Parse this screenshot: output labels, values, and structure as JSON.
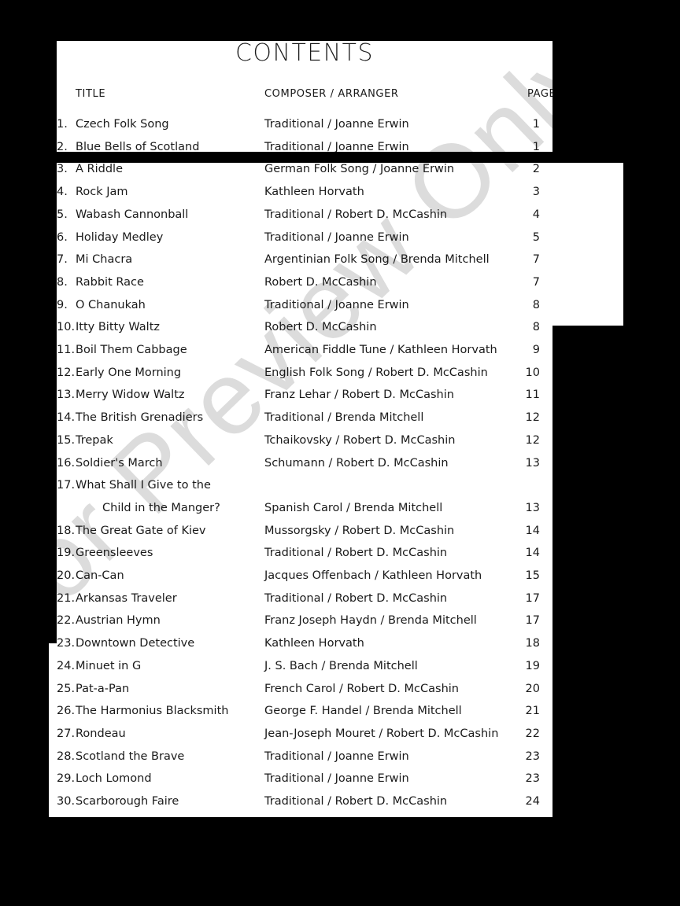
{
  "document": {
    "heading": "CONTENTS",
    "watermark": "For Preview Only",
    "watermark_color": "#dcdcdc",
    "page_background": "#ffffff",
    "canvas_background": "#000000",
    "text_color": "#1a1a1a"
  },
  "columns": {
    "title": "TITLE",
    "composer": "COMPOSER / ARRANGER",
    "page": "PAGE"
  },
  "entries": [
    {
      "num": "1.",
      "title": "Czech Folk Song",
      "composer": "Traditional / Joanne Erwin",
      "page": "1"
    },
    {
      "num": "2.",
      "title": "Blue Bells of Scotland",
      "composer": "Traditional / Joanne Erwin",
      "page": "1"
    },
    {
      "num": "3.",
      "title": "A Riddle",
      "composer": "German Folk Song / Joanne Erwin",
      "page": "2"
    },
    {
      "num": "4.",
      "title": "Rock Jam",
      "composer": "Kathleen Horvath",
      "page": "3"
    },
    {
      "num": "5.",
      "title": "Wabash Cannonball",
      "composer": "Traditional / Robert D. McCashin",
      "page": "4"
    },
    {
      "num": "6.",
      "title": "Holiday Medley",
      "composer": "Traditional / Joanne Erwin",
      "page": "5"
    },
    {
      "num": "7.",
      "title": "Mi Chacra",
      "composer": "Argentinian Folk Song / Brenda Mitchell",
      "page": "7"
    },
    {
      "num": "8.",
      "title": "Rabbit Race",
      "composer": "Robert D. McCashin",
      "page": "7"
    },
    {
      "num": "9.",
      "title": "O Chanukah",
      "composer": "Traditional / Joanne Erwin",
      "page": "8"
    },
    {
      "num": "10.",
      "title": "Itty Bitty Waltz",
      "composer": "Robert D. McCashin",
      "page": "8"
    },
    {
      "num": "11.",
      "title": "Boil Them Cabbage",
      "composer": "American Fiddle Tune / Kathleen Horvath",
      "page": "9"
    },
    {
      "num": "12.",
      "title": "Early One Morning",
      "composer": "English Folk Song / Robert D. McCashin",
      "page": "10"
    },
    {
      "num": "13.",
      "title": "Merry Widow Waltz",
      "composer": "Franz Lehar / Robert D. McCashin",
      "page": "11"
    },
    {
      "num": "14.",
      "title": "The British Grenadiers",
      "composer": "Traditional  / Brenda Mitchell",
      "page": "12"
    },
    {
      "num": "15.",
      "title": "Trepak",
      "composer": "Tchaikovsky / Robert D. McCashin",
      "page": "12"
    },
    {
      "num": "16.",
      "title": "Soldier's March",
      "composer": "Schumann / Robert D. McCashin",
      "page": "13"
    },
    {
      "num": "17.",
      "title": "What Shall I Give to the",
      "composer": "",
      "page": ""
    },
    {
      "num": "",
      "title": "Child in the Manger?",
      "composer": "Spanish Carol / Brenda Mitchell",
      "page": "13",
      "indented": true
    },
    {
      "num": "18.",
      "title": "The Great Gate of Kiev",
      "composer": "Mussorgsky / Robert D. McCashin",
      "page": "14"
    },
    {
      "num": "19.",
      "title": "Greensleeves",
      "composer": "Traditional / Robert D. McCashin",
      "page": "14"
    },
    {
      "num": "20.",
      "title": "Can-Can",
      "composer": "Jacques Offenbach / Kathleen Horvath",
      "page": "15"
    },
    {
      "num": "21.",
      "title": "Arkansas Traveler",
      "composer": "Traditional / Robert D. McCashin",
      "page": "17"
    },
    {
      "num": "22.",
      "title": "Austrian Hymn",
      "composer": "Franz Joseph Haydn / Brenda Mitchell",
      "page": "17"
    },
    {
      "num": "23.",
      "title": "Downtown Detective",
      "composer": "Kathleen Horvath",
      "page": "18"
    },
    {
      "num": "24.",
      "title": "Minuet in G",
      "composer": "J. S. Bach / Brenda Mitchell",
      "page": "19"
    },
    {
      "num": "25.",
      "title": "Pat-a-Pan",
      "composer": "French Carol / Robert D. McCashin",
      "page": "20"
    },
    {
      "num": "26.",
      "title": "The Harmonius Blacksmith",
      "composer": "George F. Handel / Brenda Mitchell",
      "page": "21"
    },
    {
      "num": "27.",
      "title": "Rondeau",
      "composer": "Jean-Joseph Mouret / Robert D. McCashin",
      "page": "22"
    },
    {
      "num": "28.",
      "title": "Scotland the Brave",
      "composer": "Traditional / Joanne Erwin",
      "page": "23"
    },
    {
      "num": "29.",
      "title": "Loch Lomond",
      "composer": "Traditional / Joanne Erwin",
      "page": "23"
    },
    {
      "num": "30.",
      "title": "Scarborough Faire",
      "composer": "Traditional / Robert D. McCashin",
      "page": "24"
    }
  ]
}
